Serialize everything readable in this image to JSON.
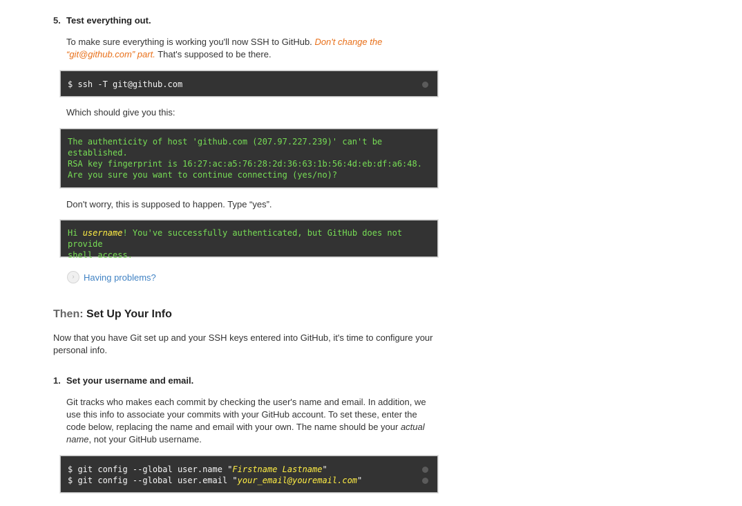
{
  "step5": {
    "number": "5.",
    "title": "Test everything out.",
    "intro_line1": "To make sure everything is working you'll now SSH to GitHub.",
    "warning_part1": "Don't change the",
    "warning_part2": "“git@github.com” part.",
    "intro_end": "That's supposed to be there.",
    "command": "$ ssh -T git@github.com",
    "result_intro": "Which should give you this:",
    "output_line1": "The authenticity of host 'github.com (207.97.227.239)' can't be",
    "output_line2": "established.",
    "output_line3": "RSA key fingerprint is 16:27:ac:a5:76:28:2d:36:63:1b:56:4d:eb:df:a6:48.",
    "output_line4": "Are you sure you want to continue connecting (yes/no)?",
    "worry_text": "Don't worry, this is supposed to happen. Type “yes”.",
    "success_prefix": "Hi ",
    "success_username": "username",
    "success_rest": "! You've successfully authenticated, but GitHub does not provide",
    "success_line2": "shell access.",
    "help_link": "Having problems?",
    "help_icon": "chevron-right-icon"
  },
  "section": {
    "label": "Then:",
    "title": "Set Up Your Info",
    "intro_line1": "Now that you have Git set up and your SSH keys entered into GitHub, it's time to configure your",
    "intro_line2": "personal info."
  },
  "step1": {
    "number": "1.",
    "title": "Set your username and email.",
    "line1": "Git tracks who makes each commit by checking the user's name and email. In addition, we",
    "line2": "use this info to associate your commits with your GitHub account. To set these, enter the",
    "line3_a": "code below, replacing the name and email with your own. The name should be your",
    "line3_b": "actual",
    "line4_a": "name",
    "line4_b": ", not your GitHub username.",
    "cmd1_prefix": "$ git config --global user.name \"",
    "cmd1_value": "Firstname Lastname",
    "cmd1_suffix": "\"",
    "cmd2_prefix": "$ git config --global user.email \"",
    "cmd2_value": "your_email@youremail.com",
    "cmd2_suffix": "\""
  },
  "colors": {
    "code_background": "#333333",
    "output_text": "#77dd55",
    "highlight": "#ffee44",
    "warning": "#e8701a",
    "link": "#4183c4"
  }
}
